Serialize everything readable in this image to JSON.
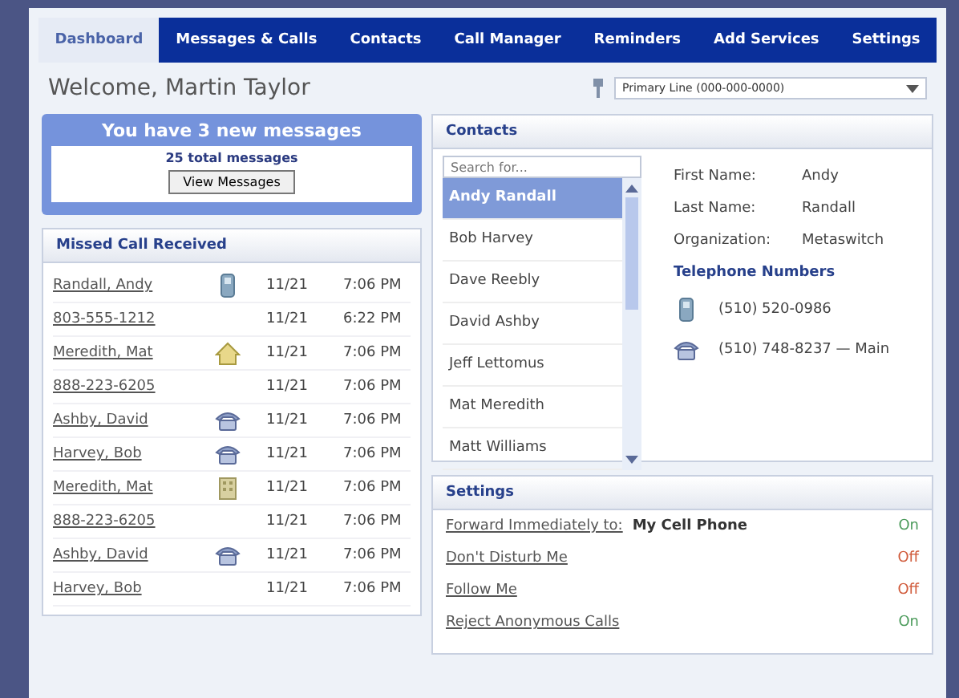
{
  "tabs": [
    {
      "label": "Dashboard",
      "selected": true
    },
    {
      "label": "Messages & Calls",
      "selected": false
    },
    {
      "label": "Contacts",
      "selected": false
    },
    {
      "label": "Call Manager",
      "selected": false
    },
    {
      "label": "Reminders",
      "selected": false
    },
    {
      "label": "Add Services",
      "selected": false
    },
    {
      "label": "Settings",
      "selected": false
    }
  ],
  "welcome": "Welcome, Martin Taylor",
  "line_select": {
    "value": "Primary Line (000-000-0000)"
  },
  "messages": {
    "headline": "You have 3 new messages",
    "total": "25 total messages",
    "button": "View Messages"
  },
  "missed_calls": {
    "title": "Missed Call Received",
    "rows": [
      {
        "caller": "Randall, Andy",
        "kind": "mobile",
        "date": "11/21",
        "time": "7:06 PM"
      },
      {
        "caller": "803-555-1212",
        "kind": "none",
        "date": "11/21",
        "time": "6:22 PM"
      },
      {
        "caller": "Meredith, Mat",
        "kind": "home",
        "date": "11/21",
        "time": "7:06 PM"
      },
      {
        "caller": "888-223-6205",
        "kind": "none",
        "date": "11/21",
        "time": "7:06 PM"
      },
      {
        "caller": "Ashby, David",
        "kind": "desk",
        "date": "11/21",
        "time": "7:06 PM"
      },
      {
        "caller": "Harvey, Bob",
        "kind": "desk",
        "date": "11/21",
        "time": "7:06 PM"
      },
      {
        "caller": "Meredith, Mat",
        "kind": "work",
        "date": "11/21",
        "time": "7:06 PM"
      },
      {
        "caller": "888-223-6205",
        "kind": "none",
        "date": "11/21",
        "time": "7:06 PM"
      },
      {
        "caller": "Ashby, David",
        "kind": "desk",
        "date": "11/21",
        "time": "7:06 PM"
      },
      {
        "caller": "Harvey, Bob",
        "kind": "none",
        "date": "11/21",
        "time": "7:06 PM"
      }
    ]
  },
  "contacts": {
    "title": "Contacts",
    "search": {
      "placeholder": "Search for..."
    },
    "list": [
      {
        "name": "Andy Randall",
        "selected": true
      },
      {
        "name": "Bob Harvey",
        "selected": false
      },
      {
        "name": "Dave Reebly",
        "selected": false
      },
      {
        "name": "David Ashby",
        "selected": false
      },
      {
        "name": "Jeff Lettomus",
        "selected": false
      },
      {
        "name": "Mat Meredith",
        "selected": false
      },
      {
        "name": "Matt Williams",
        "selected": false
      }
    ],
    "details": [
      {
        "label": "First Name:",
        "value": "Andy"
      },
      {
        "label": "Last Name:",
        "value": "Randall"
      },
      {
        "label": "Organization:",
        "value": "Metaswitch"
      }
    ],
    "phones_title": "Telephone Numbers",
    "phones": [
      {
        "kind": "mobile",
        "number": "(510) 520-0986"
      },
      {
        "kind": "desk",
        "number": "(510) 748-8237 — Main"
      }
    ]
  },
  "settings": {
    "title": "Settings",
    "rows": [
      {
        "label": "Forward Immediately to:",
        "target": "My Cell Phone",
        "status": "On",
        "on": true
      },
      {
        "label": "Don't Disturb Me",
        "status": "Off",
        "on": false
      },
      {
        "label": "Follow Me",
        "status": "Off",
        "on": false
      },
      {
        "label": "Reject Anonymous Calls",
        "status": "On",
        "on": true
      }
    ]
  }
}
